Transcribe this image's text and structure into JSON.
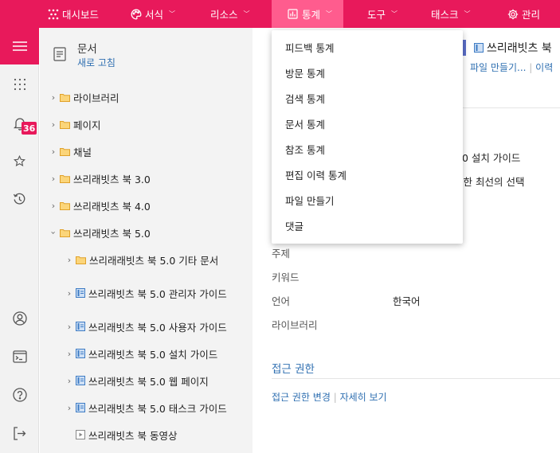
{
  "topnav": {
    "items": [
      {
        "label": "대시보드",
        "icon": "dashboard-icon"
      },
      {
        "label": "서식",
        "icon": "palette-icon"
      },
      {
        "label": "리소스",
        "icon": ""
      },
      {
        "label": "통계",
        "icon": "chart-icon"
      },
      {
        "label": "도구",
        "icon": ""
      },
      {
        "label": "태스크",
        "icon": ""
      },
      {
        "label": "관리",
        "icon": "gear-icon"
      }
    ]
  },
  "rail": {
    "notification_count": "36"
  },
  "tree": {
    "title": "문서",
    "refresh": "새로 고침",
    "items": [
      {
        "label": "라이브러리"
      },
      {
        "label": "페이지"
      },
      {
        "label": "채널"
      },
      {
        "label": "쓰리래빗츠 북 3.0"
      },
      {
        "label": "쓰리래빗츠 북 4.0"
      },
      {
        "label": "쓰리래빗츠 북 5.0"
      },
      {
        "label": "쓰리래래빗츠 북 5.0 기타 문서"
      },
      {
        "label": "쓰리래빗츠 북 5.0 관리자 가이드"
      },
      {
        "label": "쓰리래빗츠 북 5.0 사용자 가이드"
      },
      {
        "label": "쓰리래빗츠 북 5.0 설치 가이드"
      },
      {
        "label": "쓰리래빗츠 북 5.0 웹 페이지"
      },
      {
        "label": "쓰리래빗츠 북 5.0 태스크 가이드"
      },
      {
        "label": "쓰리래빗츠 북 동영상"
      }
    ]
  },
  "main": {
    "doc_title": "쓰리래빗츠 북",
    "actions": {
      "make_file": "파일 만들기...",
      "history": "이력"
    },
    "title_line": "0 설치 가이드",
    "desc_line": "위한 최선의 선택",
    "fields": {
      "subject_label": "주제",
      "keyword_label": "키워드",
      "language_label": "언어",
      "language_value": "한국어",
      "library_label": "라이브러리"
    },
    "access": {
      "heading": "접근 권한",
      "change": "접근 권한 변경",
      "detail": "자세히 보기"
    }
  },
  "dropdown": {
    "items": [
      "피드백 통계",
      "방문 통계",
      "검색 통계",
      "문서 통계",
      "참조 통계",
      "편집 이력 통계",
      "파일 만들기",
      "댓글"
    ]
  },
  "colors": {
    "brand": "#e8195b",
    "link": "#2f6fb1",
    "folder": "#f5b731",
    "book": "#3d7bc4"
  }
}
